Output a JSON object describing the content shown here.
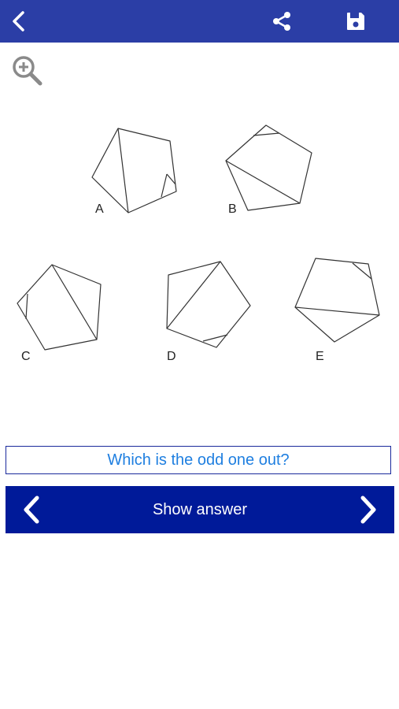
{
  "topbar": {
    "background": "#2b3ea6",
    "back_icon": "chevron-left-icon",
    "share_icon": "share-icon",
    "save_icon": "floppy-disk-icon"
  },
  "zoom": {
    "icon": "zoom-in-icon"
  },
  "figures": {
    "A": "A",
    "B": "B",
    "C": "C",
    "D": "D",
    "E": "E"
  },
  "question": {
    "text": "Which is the odd one out?"
  },
  "answer_bar": {
    "background": "#001a99",
    "prev_icon": "chevron-left-icon",
    "next_icon": "chevron-right-icon",
    "label": "Show answer"
  }
}
